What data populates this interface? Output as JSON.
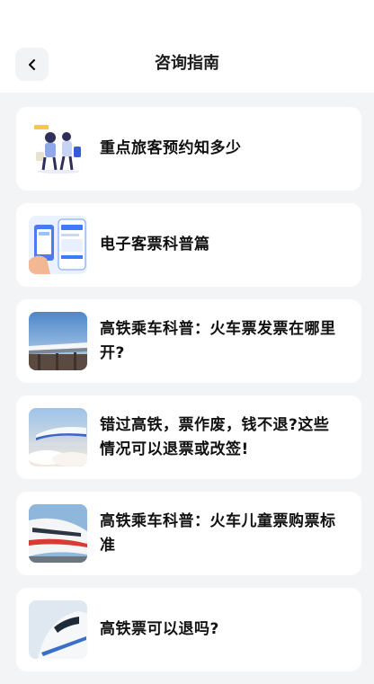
{
  "header": {
    "title": "咨询指南",
    "back_icon": "chevron-left-icon"
  },
  "articles": [
    {
      "title": "重点旅客预约知多少",
      "thumb": "family-travel-illustration"
    },
    {
      "title": "电子客票科普篇",
      "thumb": "phone-ticket-illustration"
    },
    {
      "title": "高铁乘车科普：火车票发票在哪里开?",
      "thumb": "train-bridge-photo"
    },
    {
      "title": "错过高铁，票作废，钱不退?这些情况可以退票或改签!",
      "thumb": "train-clouds-photo"
    },
    {
      "title": "高铁乘车科普：火车儿童票购票标准",
      "thumb": "white-train-photo"
    },
    {
      "title": "高铁票可以退吗?",
      "thumb": "train-front-photo"
    }
  ]
}
